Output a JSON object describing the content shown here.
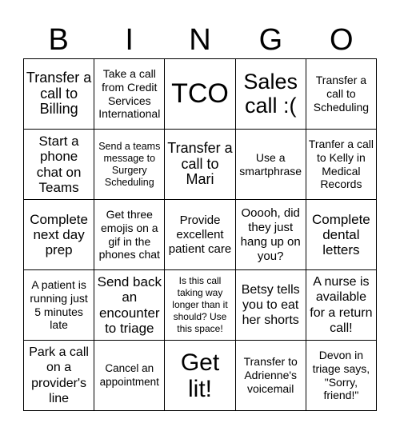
{
  "header": {
    "letters": [
      "B",
      "I",
      "N",
      "G",
      "O"
    ]
  },
  "cells": [
    [
      "Transfer a call to Billing",
      "Take a call from Credit Services International",
      "TCO",
      "Sales call :(",
      "Transfer a call to Scheduling"
    ],
    [
      "Start a phone chat on Teams",
      "Send a teams message to Surgery Scheduling",
      "Transfer a call to Mari",
      "Use a smartphrase",
      "Tranfer a call to Kelly in Medical Records"
    ],
    [
      "Complete next day prep",
      "Get three emojis on a gif in the phones chat",
      "Provide excellent patient care",
      "Ooooh, did they just hang up on you?",
      "Complete dental letters"
    ],
    [
      "A patient is running just 5 minutes late",
      "Send back an encounter to triage",
      "Is this call taking way longer than it should? Use this space!",
      "Betsy tells you to eat her shorts",
      "A nurse is available for a return call!"
    ],
    [
      "Park a call on a provider's line",
      "Cancel an appointment",
      "Get lit!",
      "Transfer to Adrienne's voicemail",
      "Devon in triage says, \"Sorry, friend!\""
    ]
  ],
  "colors": {
    "text": "#000000",
    "border": "#000000",
    "background": "#ffffff"
  }
}
